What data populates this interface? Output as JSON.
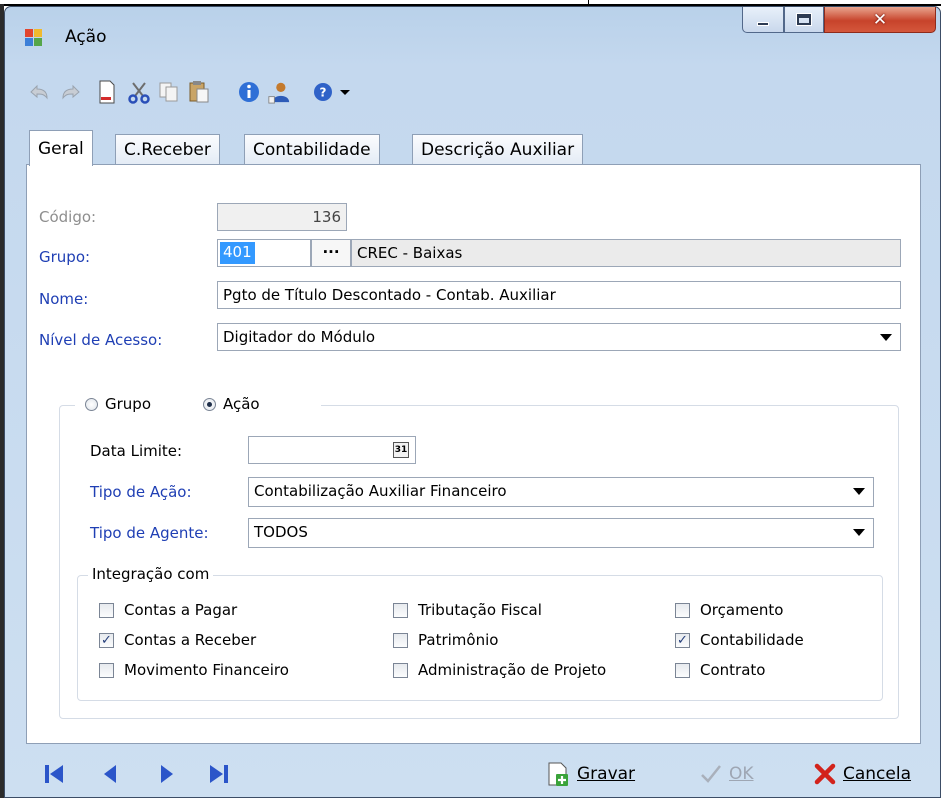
{
  "window": {
    "title": "Ação"
  },
  "toolbar": {
    "icons": [
      "undo-icon",
      "redo-icon",
      "new-document-icon",
      "cut-icon",
      "copy-icon",
      "paste-icon",
      "info-icon",
      "user-icon",
      "help-icon",
      "dropdown-arrow-icon"
    ]
  },
  "tabs": [
    {
      "label": "Geral",
      "active": true
    },
    {
      "label": "C.Receber",
      "active": false
    },
    {
      "label": "Contabilidade",
      "active": false
    },
    {
      "label": "Descrição Auxiliar",
      "active": false
    }
  ],
  "form": {
    "codigo_label": "Código:",
    "codigo_value": "136",
    "grupo_label": "Grupo:",
    "grupo_value": "401",
    "grupo_browse": "···",
    "grupo_desc": "CREC - Baixas",
    "nome_label": "Nome:",
    "nome_value": "Pgto de Título Descontado - Contab. Auxiliar",
    "nivel_label": "Nível de Acesso:",
    "nivel_value": "Digitador do Módulo"
  },
  "mode": {
    "grupo_label": "Grupo",
    "acao_label": "Ação",
    "selected": "Ação"
  },
  "action": {
    "data_limite_label": "Data Limite:",
    "data_limite_value": "",
    "tipo_acao_label": "Tipo de Ação:",
    "tipo_acao_value": "Contabilização Auxiliar Financeiro",
    "tipo_agente_label": "Tipo de Agente:",
    "tipo_agente_value": "TODOS"
  },
  "integracao": {
    "title": "Integração com",
    "items": [
      {
        "label": "Contas a Pagar",
        "checked": false
      },
      {
        "label": "Contas a Receber",
        "checked": true
      },
      {
        "label": "Movimento Financeiro",
        "checked": false
      },
      {
        "label": "Tributação Fiscal",
        "checked": false
      },
      {
        "label": "Patrimônio",
        "checked": false
      },
      {
        "label": "Administração de Projeto",
        "checked": false
      },
      {
        "label": "Orçamento",
        "checked": false
      },
      {
        "label": "Contabilidade",
        "checked": true
      },
      {
        "label": "Contrato",
        "checked": false
      }
    ]
  },
  "footer": {
    "gravar_label": "Gravar",
    "ok_label": "OK",
    "cancela_label": "Cancela"
  },
  "colors": {
    "link_blue": "#1f3fb4",
    "nav_blue": "#2b55c9",
    "cancel_red": "#d2231c"
  }
}
